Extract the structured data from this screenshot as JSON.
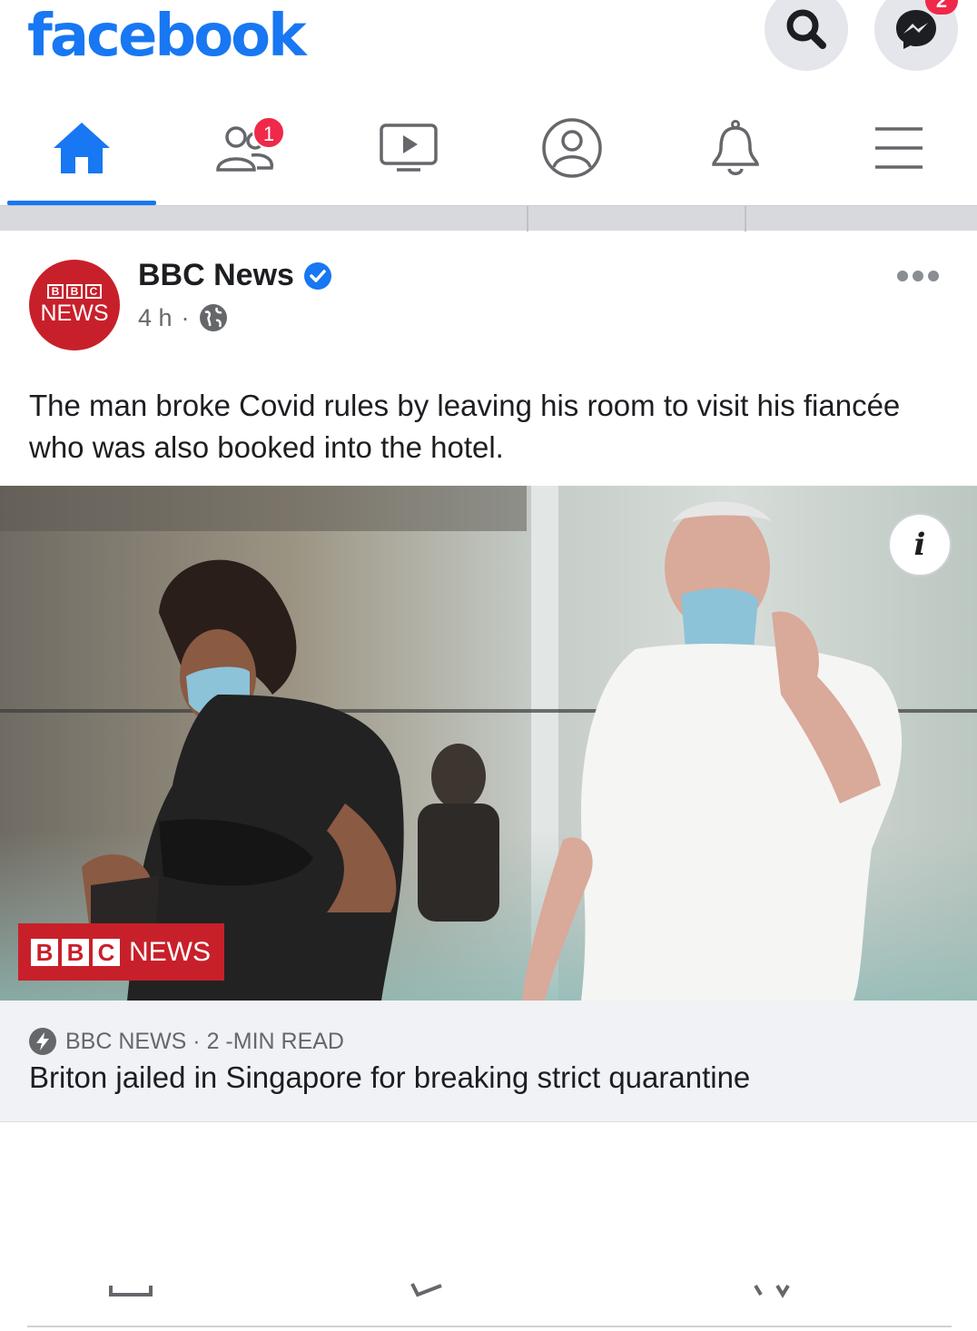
{
  "header": {
    "logo_text": "facebook",
    "search_icon": "search-icon",
    "messenger_icon": "messenger-icon",
    "messenger_badge": "2"
  },
  "nav": {
    "tabs": [
      {
        "name": "home",
        "icon": "home-icon",
        "active": true
      },
      {
        "name": "friends",
        "icon": "friends-icon",
        "badge": "1"
      },
      {
        "name": "watch",
        "icon": "video-icon"
      },
      {
        "name": "profile",
        "icon": "profile-icon"
      },
      {
        "name": "notifications",
        "icon": "bell-icon"
      },
      {
        "name": "menu",
        "icon": "hamburger-icon"
      }
    ]
  },
  "post": {
    "author": "BBC News",
    "verified": true,
    "time": "4 h",
    "separator": "·",
    "audience_icon": "globe-icon",
    "avatar_bbc": [
      "B",
      "B",
      "C"
    ],
    "avatar_news": "NEWS",
    "text": "The man broke Covid rules by leaving his room to visit his fiancée who was also booked into the hotel.",
    "image_badge_letters": [
      "B",
      "B",
      "C"
    ],
    "image_badge_word": "NEWS",
    "info_label": "i"
  },
  "link": {
    "source": "BBC NEWS · 2 -MIN READ",
    "title": "Briton jailed in Singapore for breaking strict quarantine"
  },
  "colors": {
    "brand": "#1877f2",
    "badge": "#f02849",
    "bbc_red": "#c8202a"
  }
}
